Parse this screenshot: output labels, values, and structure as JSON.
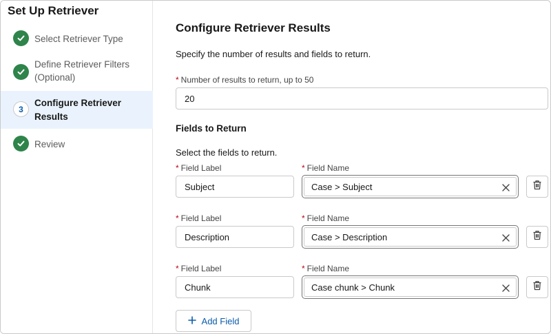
{
  "sidebar": {
    "title": "Set Up Retriever",
    "steps": [
      {
        "line1": "Select Retriever Type",
        "line2": "",
        "status": "completed"
      },
      {
        "line1": "Define Retriever Filters",
        "line2": "(Optional)",
        "status": "completed"
      },
      {
        "number": "3",
        "line1": "Configure Retriever",
        "line2": "Results",
        "status": "current"
      },
      {
        "line1": "Review",
        "line2": "",
        "status": "completed"
      }
    ]
  },
  "main": {
    "title": "Configure Retriever Results",
    "description": "Specify the number of results and fields to return.",
    "results_field": {
      "required_mark": "*",
      "label": "Number of results to return, up to 50",
      "value": "20"
    },
    "fields_section": {
      "title": "Fields to Return",
      "description": "Select the fields to return.",
      "label_header": "Field Label",
      "name_header": "Field Name",
      "required_mark": "*",
      "rows": [
        {
          "label": "Subject",
          "name": "Case > Subject"
        },
        {
          "label": "Description",
          "name": "Case > Description"
        },
        {
          "label": "Chunk",
          "name": "Case chunk > Chunk"
        }
      ]
    },
    "add_button_label": "Add Field"
  },
  "colors": {
    "brand": "#0b5cab",
    "success": "#2e844a",
    "required": "#ba0517",
    "active_bg": "#eaf3fd"
  },
  "icons": {
    "completed": "check-icon",
    "clear": "close-icon",
    "delete": "trash-icon",
    "add": "plus-icon"
  }
}
